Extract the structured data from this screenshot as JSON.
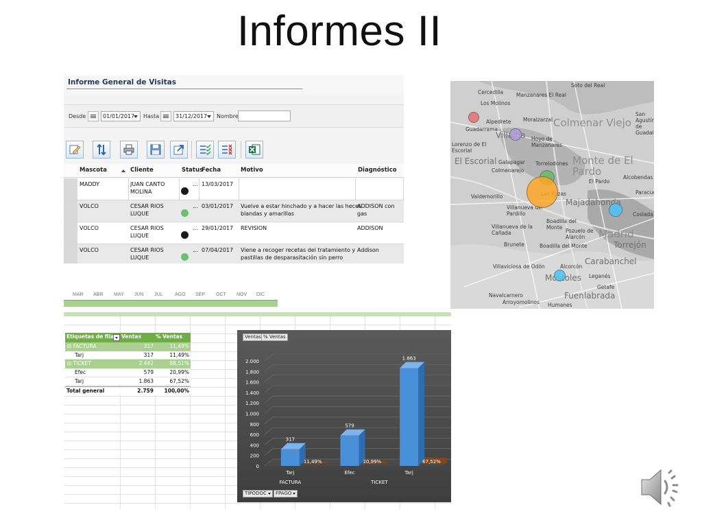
{
  "slide": {
    "title": "Informes II"
  },
  "report": {
    "title": "Informe General de Visitas",
    "filters": {
      "from_label": "Desde",
      "from_value": "01/01/2017",
      "to_label": "Hasta",
      "to_value": "31/12/2017",
      "name_label": "Nombre",
      "name_value": ""
    },
    "toolbar": [
      {
        "name": "edit-icon"
      },
      {
        "name": "sort-icon"
      },
      {
        "name": "print-icon"
      },
      {
        "name": "save-icon"
      },
      {
        "name": "export-icon"
      },
      {
        "name": "check-list-icon"
      },
      {
        "name": "uncheck-list-icon"
      },
      {
        "name": "excel-icon"
      }
    ],
    "columns": {
      "pet": "Mascota",
      "client": "Cliente",
      "status": "Status",
      "date": "Fecha",
      "reason": "Motivo",
      "diagnosis": "Diagnóstico"
    },
    "rows": [
      {
        "pet": "MADDY",
        "client": "JUAN CANTO\nMOLINA",
        "status_color": "#1a1a1a",
        "date": "13/03/2017",
        "reason": "",
        "diagnosis": ""
      },
      {
        "pet": "VOLCO",
        "client": "CESAR RIOS\nLUQUE",
        "status_color": "#6cbf72",
        "date": "03/01/2017",
        "reason": "Vuelve a estar hinchado y a hacer las heces\nblandas  y amarillas",
        "diagnosis": "ADDISON con gas"
      },
      {
        "pet": "VOLCO",
        "client": "CESAR RIOS\nLUQUE",
        "status_color": "#1a1a1a",
        "date": "29/01/2017",
        "reason": "REVISION",
        "diagnosis": "ADDISON"
      },
      {
        "pet": "VOLCO",
        "client": "CESAR RIOS\nLUQUE",
        "status_color": "#6cbf72",
        "date": "07/04/2017",
        "reason": "Viene a recoger recetas del tratamiento y\npastillas de desparasitación sin perro",
        "diagnosis": "Addison"
      }
    ],
    "ellipsis": "..."
  },
  "map": {
    "places": {
      "p1": "Soto del Real",
      "p2": "Cercedilla",
      "p3": "Manzanares El Real",
      "p4": "Los Molinos",
      "p5": "San Agustín\nde Guadalix",
      "p6": "Guadarrama",
      "p7": "Alpedrete",
      "p8": "Moralzarzal",
      "p9": "Colmenar Viejo",
      "p10": "Villalba",
      "p11": "Hoyo de\nManzanares",
      "p12": "Lorenzo de El\nEscorial",
      "p13": "El Escorial",
      "p14": "Galapagar",
      "p15": "Colmenarejo",
      "p16": "Torrelodones",
      "p17": "Monte de El\nPardo",
      "p18": "Alcobendas",
      "p19": "Valdemorillo",
      "p20": "Las Rozas",
      "p21": "Majadahonda",
      "p22": "El Pardo",
      "p23": "Villanueva del\nPardillo",
      "p24": "Boadilla del\nMonte",
      "p25": "Madrid",
      "p26": "Coslada",
      "p27": "Paracuellos",
      "p28": "Pozuelo de\nAlarcón",
      "p29": "Villanueva de la\nCañada",
      "p30": "Brunete",
      "p31": "Boadilla del Monte",
      "p32": "Alcorcón",
      "p33": "Leganés",
      "p34": "Getafe",
      "p35": "Villaviciosa de Odón",
      "p36": "Móstoles",
      "p37": "Navalcarnero",
      "p38": "Arroyomolinos",
      "p39": "Fuenlabrada",
      "p40": "Carabanchel",
      "p41": "Humanes",
      "p42": "Torrejón"
    },
    "markers": [
      {
        "color": "#e57373"
      },
      {
        "color": "#b39ddb"
      },
      {
        "color": "#66bb6a"
      },
      {
        "color": "#ffa726"
      },
      {
        "color": "#4fc3f7"
      },
      {
        "color": "#4fc3f7"
      }
    ]
  },
  "months": [
    "MAR",
    "ABR",
    "MAY",
    "JUN",
    "JUL",
    "AGO",
    "SEP",
    "OCT",
    "NOV",
    "DIC"
  ],
  "pivot": {
    "header": {
      "row_labels": "Etiquetas de fila",
      "sales": "Ventas",
      "pct": "% Ventas"
    },
    "rows": [
      {
        "label": "⊟ FACTURA",
        "sales": "317",
        "pct": "11,49%",
        "kind": "group"
      },
      {
        "label": "Tarj",
        "sales": "317",
        "pct": "11,49%",
        "kind": "item"
      },
      {
        "label": "⊟ TICKET",
        "sales": "2.442",
        "pct": "88,51%",
        "kind": "group"
      },
      {
        "label": "Efec",
        "sales": "579",
        "pct": "20,99%",
        "kind": "item"
      },
      {
        "label": "Tarj",
        "sales": "1.863",
        "pct": "67,52%",
        "kind": "item"
      },
      {
        "label": "Total general",
        "sales": "2.759",
        "pct": "100,00%",
        "kind": "total"
      }
    ]
  },
  "chart_data": {
    "type": "bar",
    "title": "",
    "buttons": [
      "Ventas",
      "% Ventas"
    ],
    "filter_buttons": [
      "TIPODOC",
      "FPAGO"
    ],
    "categories": [
      "Tarj",
      "Efec",
      "Tarj"
    ],
    "groups": [
      {
        "label": "FACTURA",
        "categories": [
          0
        ]
      },
      {
        "label": "TICKET",
        "categories": [
          1,
          2
        ]
      }
    ],
    "series": [
      {
        "name": "Ventas",
        "values": [
          317,
          579,
          1863
        ],
        "data_labels": [
          "317",
          "579",
          "1.863"
        ],
        "color": "#4a90d9"
      },
      {
        "name": "% Ventas",
        "values": [
          11.49,
          20.99,
          67.52
        ],
        "data_labels": [
          "11,49%",
          "20,99%",
          "67,52%"
        ],
        "color": "#8b4513"
      }
    ],
    "y_ticks": [
      "0",
      "200",
      "400",
      "600",
      "800",
      "1.000",
      "1.200",
      "1.400",
      "1.600",
      "1.800",
      "2.000"
    ],
    "ylim": [
      0,
      2000
    ],
    "grid": true,
    "legend": "none"
  }
}
